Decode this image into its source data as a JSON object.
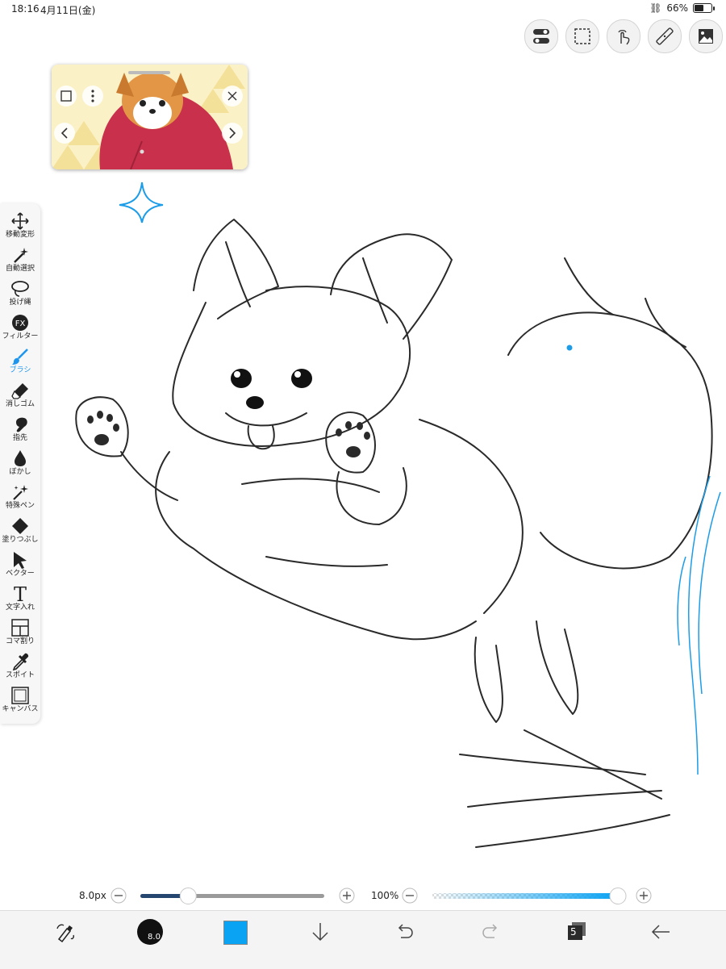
{
  "status_bar": {
    "time": "18:16",
    "date": "4月11日(金)",
    "battery": "66%",
    "battery_level": 0.66
  },
  "top_toolbar": {
    "icons": [
      "toggles-icon",
      "selection-icon",
      "gesture-icon",
      "ruler-icon",
      "image-icon"
    ]
  },
  "reference_window": {
    "icons": [
      "square-icon",
      "more-icon",
      "close-icon",
      "chevron-left-icon",
      "chevron-right-icon"
    ]
  },
  "tools": [
    {
      "label": "移動変形",
      "icon": "move-icon"
    },
    {
      "label": "自動選択",
      "icon": "magic-wand-icon"
    },
    {
      "label": "投げ縄",
      "icon": "lasso-icon"
    },
    {
      "label": "フィルター",
      "icon": "fx-icon"
    },
    {
      "label": "ブラシ",
      "icon": "brush-icon",
      "active": true
    },
    {
      "label": "消しゴム",
      "icon": "eraser-icon"
    },
    {
      "label": "指先",
      "icon": "smudge-icon"
    },
    {
      "label": "ぼかし",
      "icon": "blur-icon"
    },
    {
      "label": "特殊ペン",
      "icon": "special-pen-icon"
    },
    {
      "label": "塗りつぶし",
      "icon": "fill-icon"
    },
    {
      "label": "ベクター",
      "icon": "vector-icon"
    },
    {
      "label": "文字入れ",
      "icon": "text-icon"
    },
    {
      "label": "コマ割り",
      "icon": "frame-divider-icon"
    },
    {
      "label": "スポイト",
      "icon": "eyedropper-icon"
    },
    {
      "label": "キャンバス",
      "icon": "canvas-icon"
    }
  ],
  "brush_size": {
    "label": "8.0px",
    "level": 0.26
  },
  "opacity": {
    "label": "100%",
    "level": 1.0
  },
  "bottom_bar": {
    "brush_preview_value": "8.0",
    "color": "#0aa2f3",
    "layer_count": "5"
  },
  "colors": {
    "accent": "#1f96ee",
    "current_color": "#0aa2f3"
  }
}
